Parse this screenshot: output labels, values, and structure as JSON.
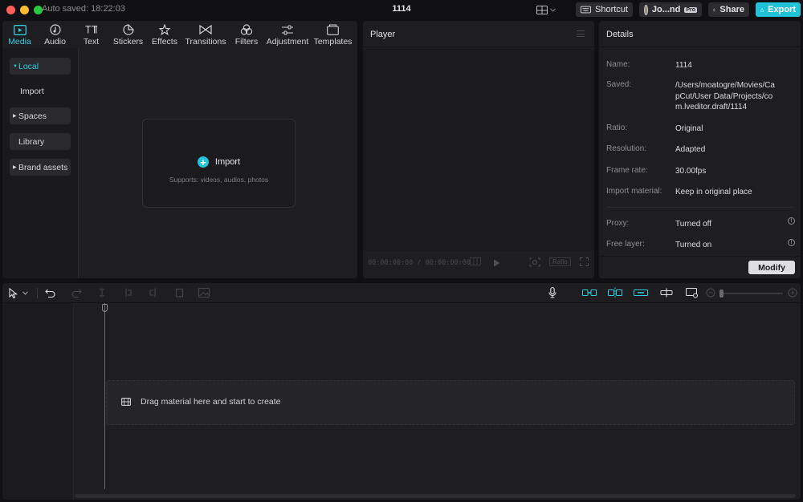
{
  "titlebar": {
    "autosave": "Auto saved: 18:22:03",
    "title": "1114",
    "shortcut_label": "Shortcut",
    "account_name": "Jo...nd",
    "pro_badge": "Pro",
    "share_label": "Share",
    "export_label": "Export"
  },
  "media": {
    "tabs": [
      {
        "label": "Media",
        "icon": "media-icon"
      },
      {
        "label": "Audio",
        "icon": "audio-icon"
      },
      {
        "label": "Text",
        "icon": "text-icon"
      },
      {
        "label": "Stickers",
        "icon": "stickers-icon"
      },
      {
        "label": "Effects",
        "icon": "effects-icon"
      },
      {
        "label": "Transitions",
        "icon": "transitions-icon"
      },
      {
        "label": "Filters",
        "icon": "filters-icon"
      },
      {
        "label": "Adjustment",
        "icon": "adjustment-icon"
      },
      {
        "label": "Templates",
        "icon": "templates-icon"
      }
    ],
    "active_tab": "Media",
    "sidebar": {
      "local": "Local",
      "import": "Import",
      "spaces": "Spaces",
      "library": "Library",
      "brand_assets": "Brand assets"
    },
    "import_box": {
      "label": "Import",
      "supports": "Supports: videos, audios, photos"
    }
  },
  "player": {
    "title": "Player",
    "time_current": "00:00:00:00",
    "time_separator": "/",
    "time_total": "00:00:00:00",
    "ratio_label": "Ratio"
  },
  "details": {
    "title": "Details",
    "rows": [
      {
        "label": "Name:",
        "value": "1114"
      },
      {
        "label": "Saved:",
        "value": "/Users/moatogre/Movies/CapCut/User Data/Projects/com.lveditor.draft/1114"
      },
      {
        "label": "Ratio:",
        "value": "Original"
      },
      {
        "label": "Resolution:",
        "value": "Adapted"
      },
      {
        "label": "Frame rate:",
        "value": "30.00fps"
      },
      {
        "label": "Import material:",
        "value": "Keep in original place"
      },
      {
        "label": "Proxy:",
        "value": "Turned off"
      },
      {
        "label": "Free layer:",
        "value": "Turned on"
      }
    ],
    "modify_label": "Modify"
  },
  "timeline": {
    "drop_hint": "Drag material here and start to create"
  },
  "colors": {
    "accent": "#22c3d8",
    "panel_bg": "#1e1e21",
    "app_bg": "#101012"
  }
}
